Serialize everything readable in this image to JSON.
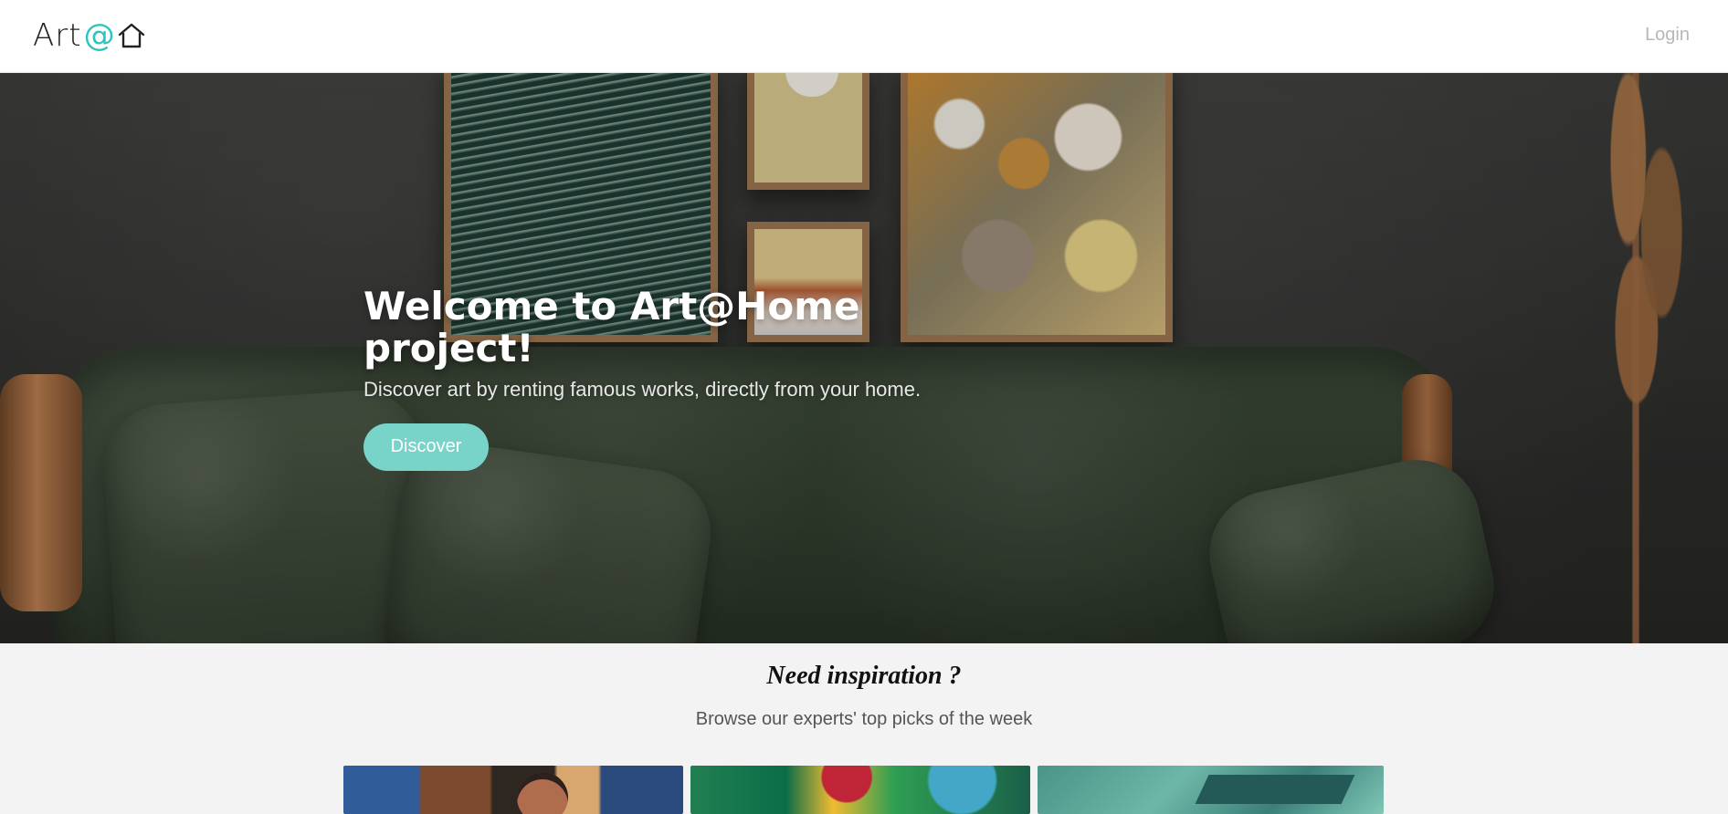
{
  "header": {
    "logo_text": "Art",
    "logo_at": "@",
    "login_label": "Login"
  },
  "hero": {
    "title": "Welcome to Art@Home project!",
    "subtitle": "Discover art by renting famous works, directly from your home.",
    "cta_label": "Discover"
  },
  "inspiration": {
    "title": "Need inspiration ?",
    "subtitle": "Browse our experts' top picks of the week"
  }
}
